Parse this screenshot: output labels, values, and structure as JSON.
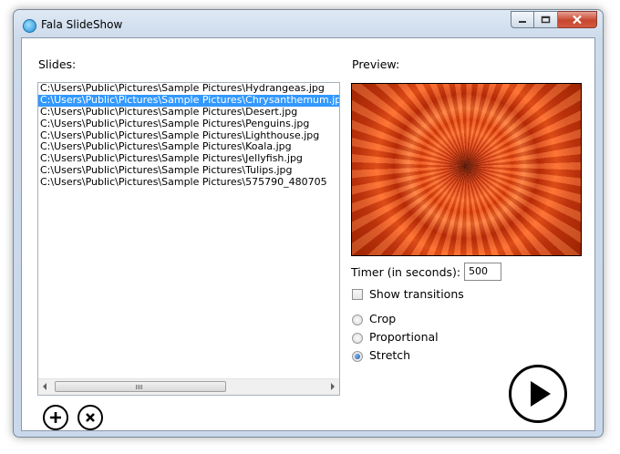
{
  "window": {
    "title": "Fala SlideShow",
    "icon": "app-globe-icon",
    "controls": [
      "minimize-icon",
      "maximize-icon",
      "close-icon"
    ]
  },
  "slides": {
    "label": "Slides:",
    "items": [
      "C:\\Users\\Public\\Pictures\\Sample Pictures\\Hydrangeas.jpg",
      "C:\\Users\\Public\\Pictures\\Sample Pictures\\Chrysanthemum.jpg",
      "C:\\Users\\Public\\Pictures\\Sample Pictures\\Desert.jpg",
      "C:\\Users\\Public\\Pictures\\Sample Pictures\\Penguins.jpg",
      "C:\\Users\\Public\\Pictures\\Sample Pictures\\Lighthouse.jpg",
      "C:\\Users\\Public\\Pictures\\Sample Pictures\\Koala.jpg",
      "C:\\Users\\Public\\Pictures\\Sample Pictures\\Jellyfish.jpg",
      "C:\\Users\\Public\\Pictures\\Sample Pictures\\Tulips.jpg",
      "C:\\Users\\Public\\Pictures\\Sample Pictures\\575790_480705"
    ],
    "selected_index": 1,
    "add_button_icon": "plus-icon",
    "remove_button_icon": "x-circle-icon"
  },
  "preview": {
    "label": "Preview:",
    "image": "orange chrysanthemum flower"
  },
  "timer": {
    "label": "Timer (in seconds):",
    "value": "500"
  },
  "transitions": {
    "label": "Show transitions",
    "checked": false
  },
  "scaling": {
    "options": [
      "Crop",
      "Proportional",
      "Stretch"
    ],
    "selected": "Stretch"
  },
  "play_button_icon": "play-icon",
  "colors": {
    "selection": "#3399ff",
    "close_button": "#c7462f"
  }
}
